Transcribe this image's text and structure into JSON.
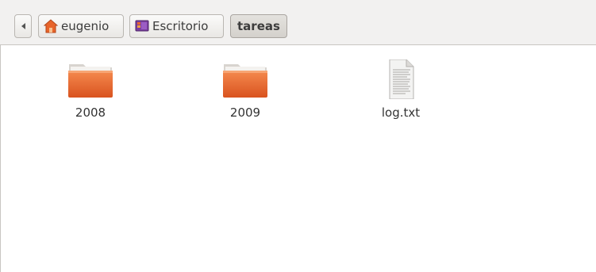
{
  "breadcrumb": {
    "back_label": "",
    "items": [
      {
        "label": "eugenio",
        "icon": "home-folder-icon"
      },
      {
        "label": "Escritorio",
        "icon": "desktop-icon"
      },
      {
        "label": "tareas",
        "icon": "",
        "active": true
      }
    ]
  },
  "files": [
    {
      "name": "2008",
      "type": "folder",
      "icon": "folder-icon"
    },
    {
      "name": "2009",
      "type": "folder",
      "icon": "folder-icon"
    },
    {
      "name": "log.txt",
      "type": "text-file",
      "icon": "text-file-icon"
    }
  ],
  "colors": {
    "folder_orange": "#e8642a",
    "toolbar_bg": "#f2f1f0",
    "desktop_icon_purple": "#7b3fa0"
  }
}
